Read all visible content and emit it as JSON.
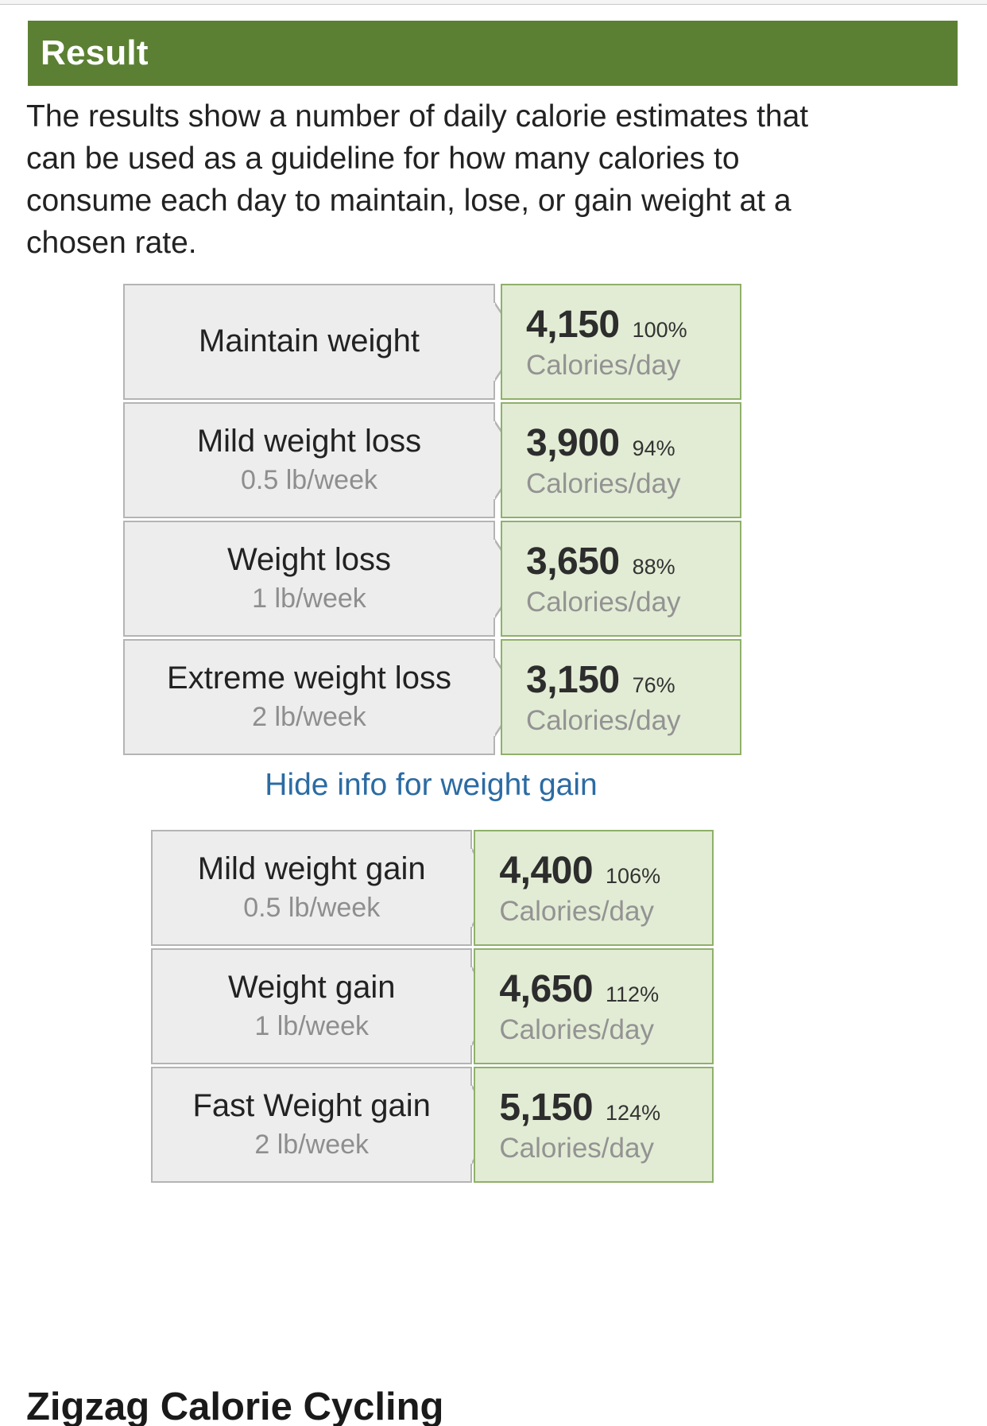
{
  "header": {
    "title": "Result",
    "bar_color": "#5b8033"
  },
  "intro": {
    "text": "The results show a number of daily calorie estimates that can be used as a guideline for how many calories to consume each day to maintain, lose, or gain weight at a chosen rate."
  },
  "units": {
    "calories_per_day": "Calories/day"
  },
  "weight_loss_rows": [
    {
      "label": "Maintain weight",
      "rate": "",
      "calories": "4,150",
      "percent": "100%",
      "unit": "Calories/day"
    },
    {
      "label": "Mild weight loss",
      "rate": "0.5 lb/week",
      "calories": "3,900",
      "percent": "94%",
      "unit": "Calories/day"
    },
    {
      "label": "Weight loss",
      "rate": "1 lb/week",
      "calories": "3,650",
      "percent": "88%",
      "unit": "Calories/day"
    },
    {
      "label": "Extreme weight loss",
      "rate": "2 lb/week",
      "calories": "3,150",
      "percent": "76%",
      "unit": "Calories/day"
    }
  ],
  "toggle_link": {
    "label": "Hide info for weight gain",
    "color": "#2b6ba3"
  },
  "weight_gain_rows": [
    {
      "label": "Mild weight gain",
      "rate": "0.5 lb/week",
      "calories": "4,400",
      "percent": "106%",
      "unit": "Calories/day"
    },
    {
      "label": "Weight gain",
      "rate": "1 lb/week",
      "calories": "4,650",
      "percent": "112%",
      "unit": "Calories/day"
    },
    {
      "label": "Fast Weight gain",
      "rate": "2 lb/week",
      "calories": "5,150",
      "percent": "124%",
      "unit": "Calories/day"
    }
  ],
  "next_section": {
    "heading": "Zigzag Calorie Cycling"
  },
  "colors": {
    "header_green": "#5b8033",
    "value_box_bg": "#e2ecd4",
    "value_box_border": "#8fb06a",
    "label_box_bg": "#ededed",
    "label_box_border": "#b4b4b4",
    "link_blue": "#2b6ba3",
    "muted_text": "#939393"
  }
}
